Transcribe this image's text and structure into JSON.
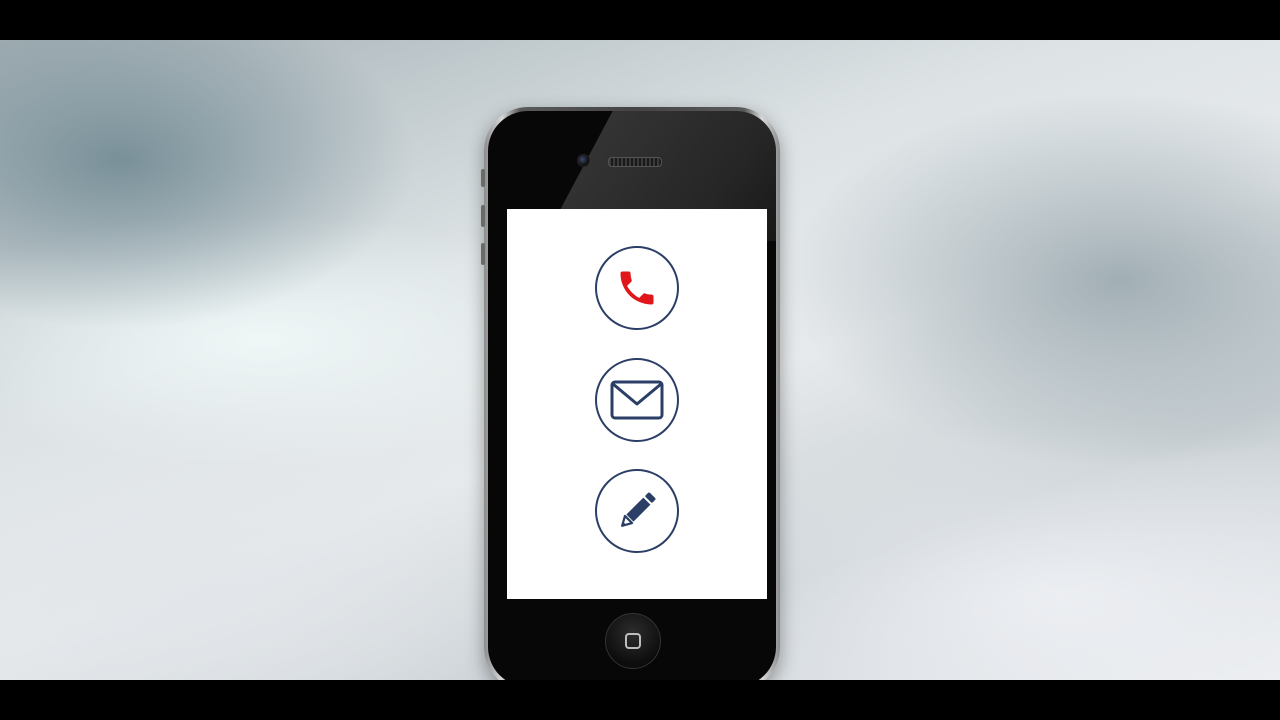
{
  "scene": {
    "background_colors": [
      "#a4b0b5",
      "#e7eaec",
      "#c9d0d4"
    ],
    "letterbox_color": "#000000"
  },
  "phone": {
    "frame_color": "#070707",
    "screen_color": "#ffffff",
    "apps": [
      {
        "name": "phone-call",
        "icon": "phone-icon",
        "icon_color": "#e0161b",
        "ring_color": "#2b3e66"
      },
      {
        "name": "mail",
        "icon": "envelope-icon",
        "icon_color": "#2b3e66",
        "ring_color": "#2b3e66"
      },
      {
        "name": "edit",
        "icon": "pencil-icon",
        "icon_color": "#2b3e66",
        "ring_color": "#2b3e66"
      }
    ],
    "home_button_icon": "home-square-icon"
  }
}
